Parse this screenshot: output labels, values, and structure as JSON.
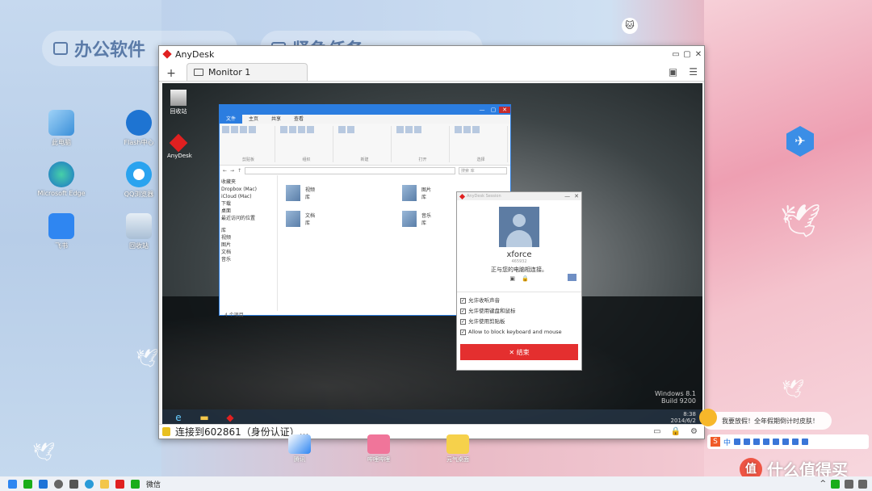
{
  "wallpaper": {
    "group_left": "办公软件",
    "group_right": "紧急任务"
  },
  "desktop_icons": [
    {
      "label": "此电脑"
    },
    {
      "label": "Flash中心"
    },
    {
      "label": "Microsoft Edge"
    },
    {
      "label": "QQ浏览器"
    },
    {
      "label": "飞书"
    },
    {
      "label": "回收站"
    }
  ],
  "anydesk": {
    "title": "AnyDesk",
    "tab_label": "Monitor 1",
    "status_text": "连接到602861（身份认证）..."
  },
  "remote_desktop": {
    "icons": [
      {
        "label": "回收站"
      },
      {
        "label": "AnyDesk"
      }
    ],
    "windows_label": "Windows 8.1",
    "build": "Build 9200",
    "clock_time": "8:38",
    "clock_date": "2014/6/2"
  },
  "explorer": {
    "tabs": [
      "文件",
      "主页",
      "共享",
      "查看"
    ],
    "ribbon_groups": [
      "剪贴板",
      "组织",
      "新建",
      "打开",
      "选择"
    ],
    "search_placeholder": "搜索 库",
    "nav": [
      "收藏夹",
      "Dropbox (Mac)",
      "iCloud (Mac)",
      "下载",
      "桌面",
      "最近访问的位置"
    ],
    "nav_lib": [
      "库",
      "视频",
      "图片",
      "文档",
      "音乐"
    ],
    "files": [
      {
        "name": "视频",
        "sub": "库"
      },
      {
        "name": "图片",
        "sub": "库"
      },
      {
        "name": "文档",
        "sub": "库"
      },
      {
        "name": "音乐",
        "sub": "库"
      }
    ],
    "status": "4 个项目"
  },
  "dialog": {
    "title": "AnyDesk Session",
    "name": "xforce",
    "id": "465932",
    "message": "正与您的电脑相连接。",
    "options": [
      "允许收听声音",
      "允许使用键盘和鼠标",
      "允许使用剪贴板",
      "Allow to block keyboard and mouse"
    ],
    "end_label": "✕ 结束"
  },
  "bottom_icons": [
    {
      "label": "腾讯"
    },
    {
      "label": "哔哩哔哩"
    },
    {
      "label": "元气桌面"
    }
  ],
  "notification": "我要放假！全年假期倒计时皮肤！",
  "ime": {
    "lang": "中"
  },
  "taskbar": {
    "wechat": "微信"
  },
  "watermark": "什么值得买",
  "colors": {
    "anydesk_red": "#e02020",
    "explorer_blue": "#2b7de0",
    "end_button": "#e42f2f"
  }
}
